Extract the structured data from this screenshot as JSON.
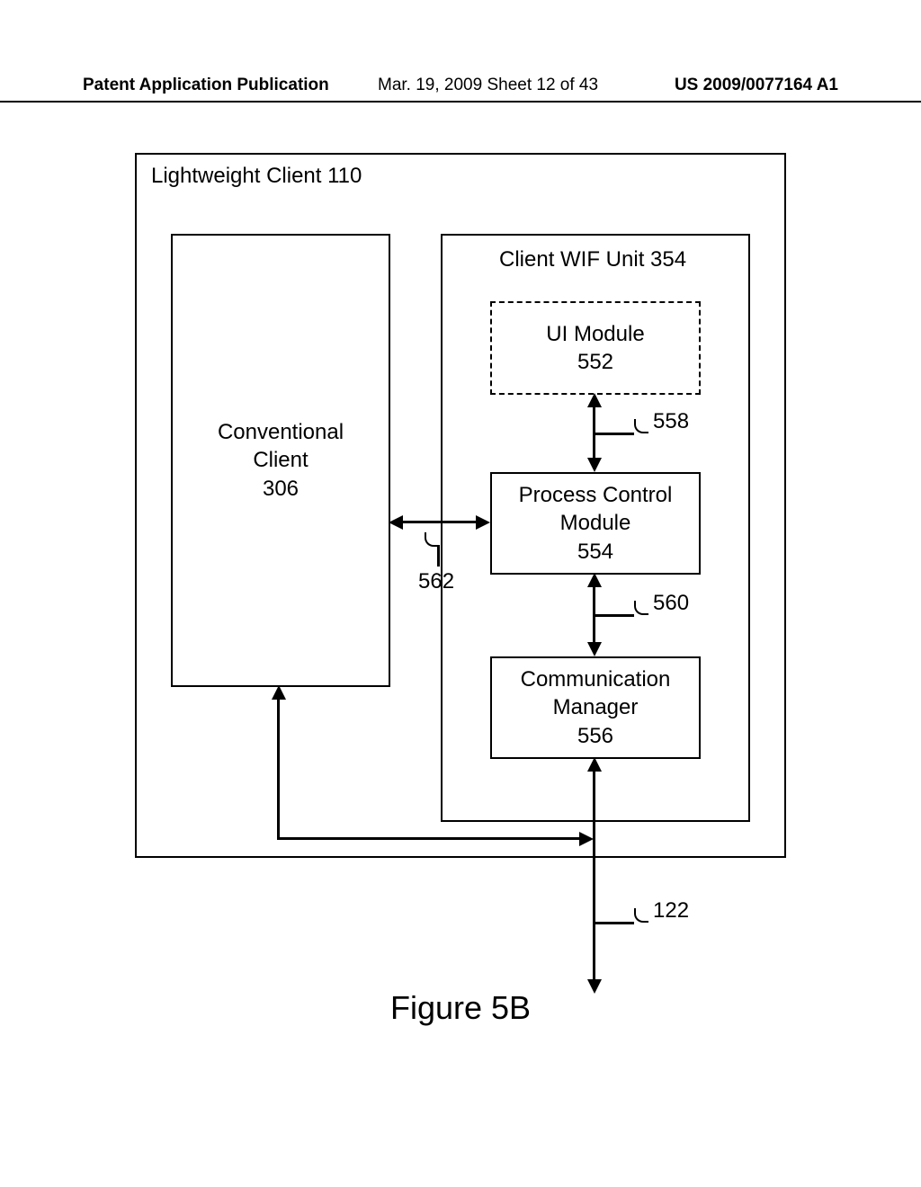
{
  "header": {
    "pub": "Patent Application Publication",
    "date": "Mar. 19, 2009  Sheet 12 of 43",
    "pub_no": "US 2009/0077164 A1"
  },
  "figure": {
    "caption": "Figure 5B",
    "outer_label": "Lightweight Client 110",
    "conventional_client": "Conventional\nClient\n306",
    "wif_unit_label": "Client WIF Unit 354",
    "ui_module": "UI Module\n552",
    "process_control": "Process Control\nModule\n554",
    "comm_manager": "Communication\nManager\n556",
    "ref_558": "558",
    "ref_560": "560",
    "ref_562": "562",
    "ref_122": "122"
  }
}
